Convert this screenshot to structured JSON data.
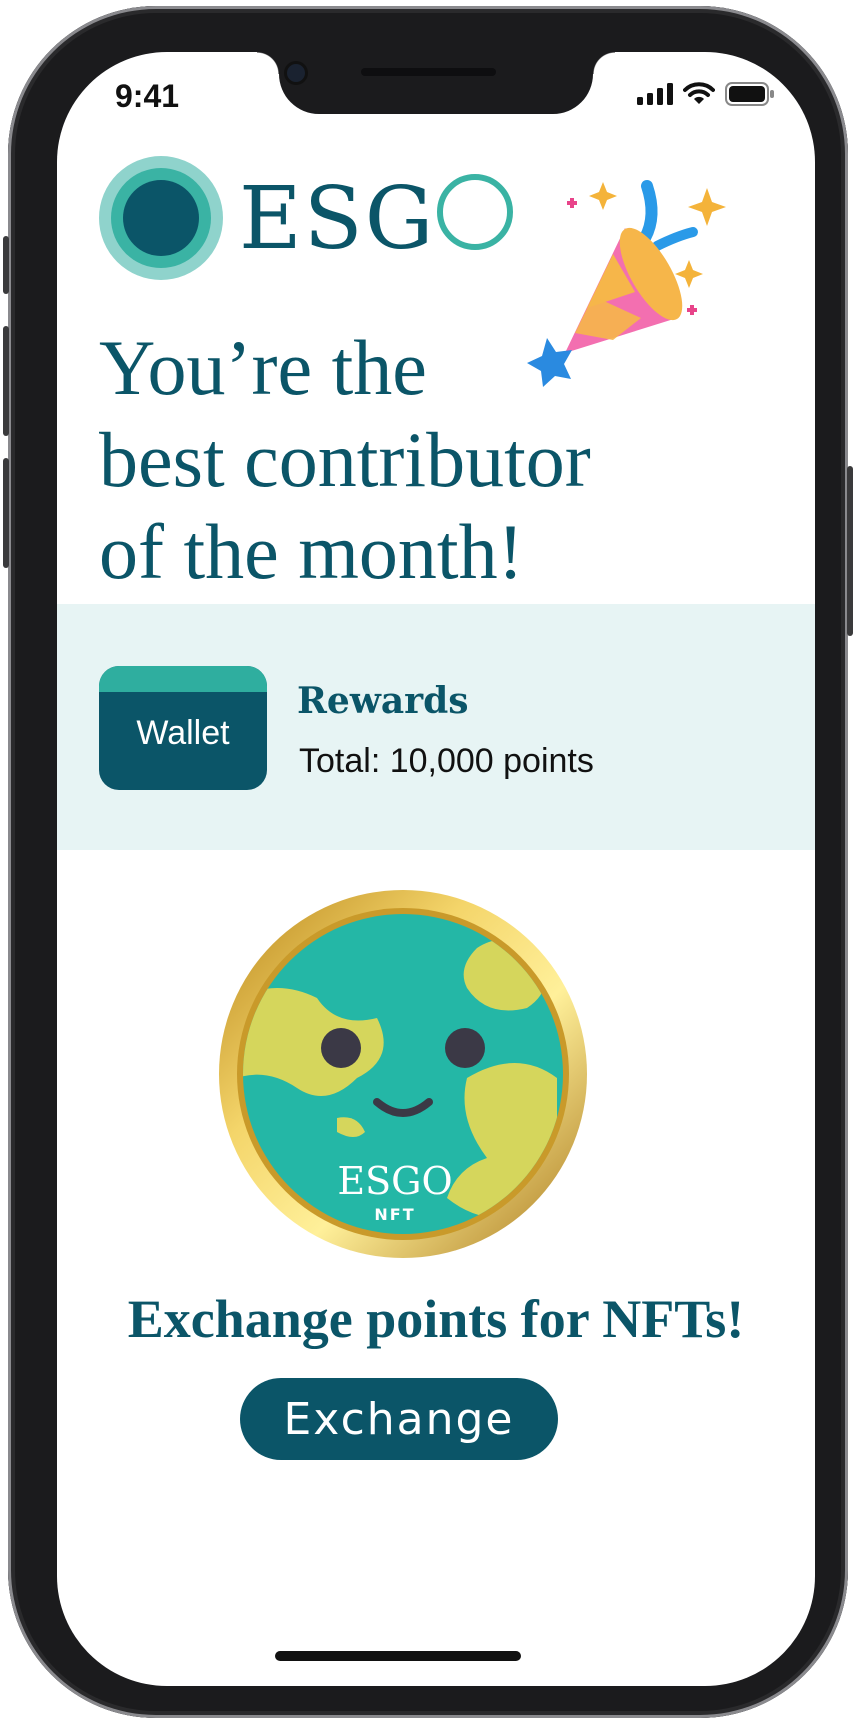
{
  "status_bar": {
    "time": "9:41"
  },
  "logo": {
    "text": "ESG"
  },
  "headline": {
    "line1": "You’re the",
    "line2": "best contributor",
    "line3": "of the month!"
  },
  "wallet": {
    "label": "Wallet"
  },
  "rewards": {
    "title": "Rewards",
    "total": "Total: 10,000 points"
  },
  "nft_badge": {
    "brand": "ESGO",
    "sub": "NFT"
  },
  "exchange": {
    "prompt": "Exchange points for NFTs!",
    "button_label": "Exchange"
  },
  "colors": {
    "primary": "#0b5568",
    "accent": "#3ab3a4",
    "band": "#e7f4f4",
    "gold": "#d9a826"
  }
}
